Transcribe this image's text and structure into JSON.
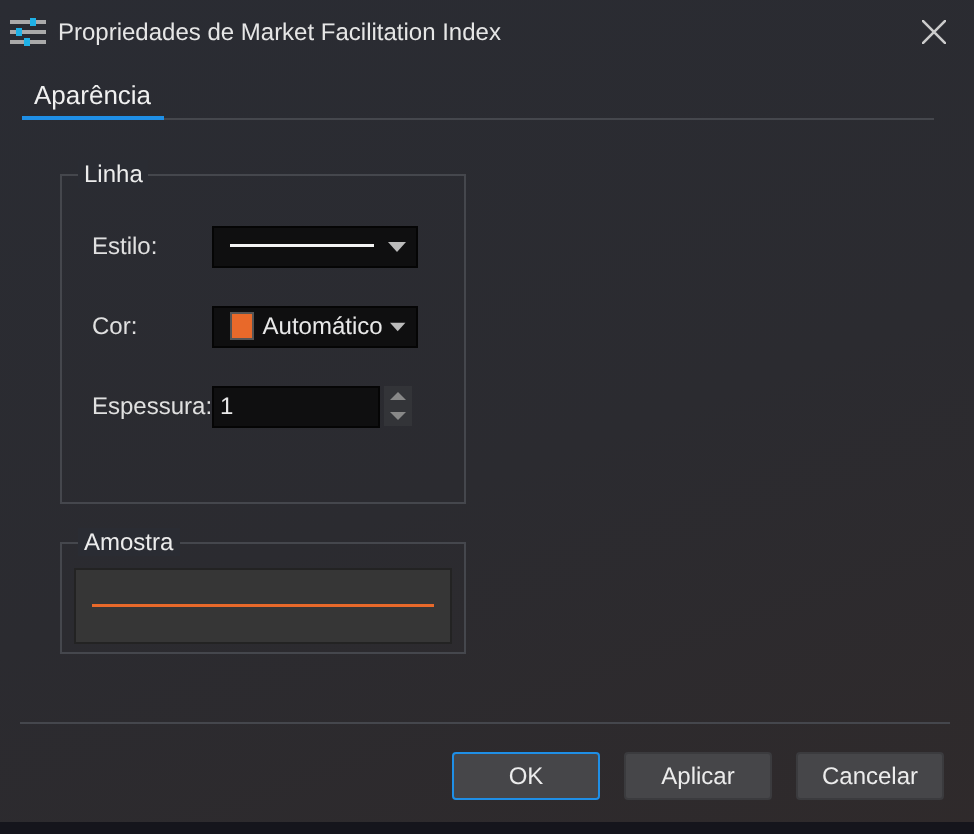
{
  "window": {
    "title": "Propriedades de Market Facilitation Index"
  },
  "tabs": [
    {
      "label": "Aparência",
      "selected": true
    }
  ],
  "line_group": {
    "title": "Linha",
    "fields": [
      {
        "kind": "line-style",
        "label": "Estilo:"
      },
      {
        "kind": "color",
        "label": "Cor:",
        "value": "Automático",
        "color": "#e8692a"
      },
      {
        "kind": "spin",
        "label": "Espessura:",
        "value": "1"
      }
    ]
  },
  "sample_group": {
    "title": "Amostra"
  },
  "buttons": [
    {
      "label": "OK",
      "selected": true
    },
    {
      "label": "Aplicar",
      "selected": false
    },
    {
      "label": "Cancelar",
      "selected": false
    }
  ]
}
